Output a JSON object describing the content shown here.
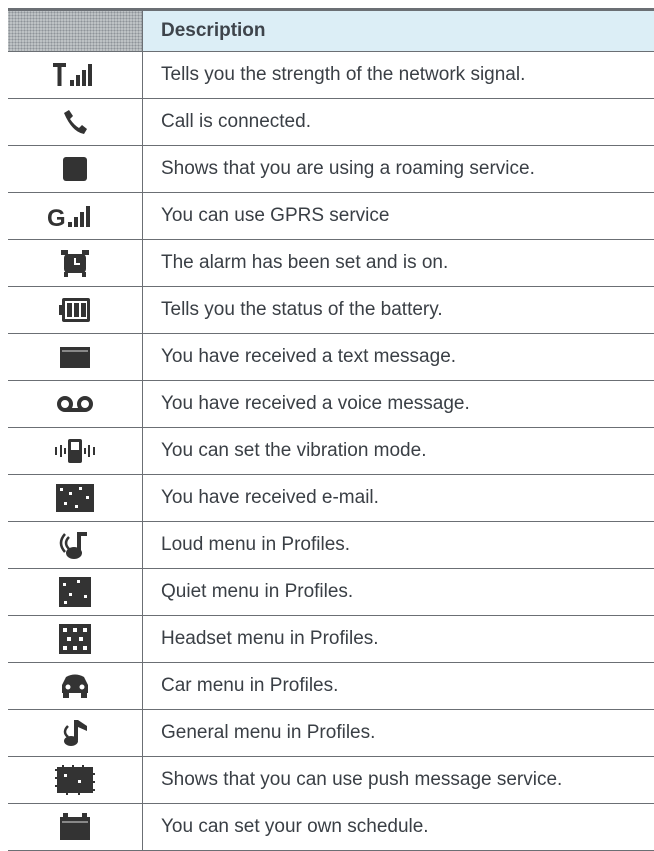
{
  "table": {
    "header": {
      "icon_col": "",
      "description_col": "Description"
    },
    "rows": [
      {
        "icon": "signal-strength-icon",
        "text": "Tells you the strength of the network signal."
      },
      {
        "icon": "call-icon",
        "text": "Call is connected."
      },
      {
        "icon": "roaming-icon",
        "text": "Shows that you are using a roaming service."
      },
      {
        "icon": "gprs-icon",
        "text": "You can use GPRS service"
      },
      {
        "icon": "alarm-icon",
        "text": "The alarm has been set and is on."
      },
      {
        "icon": "battery-icon",
        "text": "Tells you the status of the battery."
      },
      {
        "icon": "text-message-icon",
        "text": "You have received a text message."
      },
      {
        "icon": "voice-message-icon",
        "text": "You have received a voice message."
      },
      {
        "icon": "vibration-icon",
        "text": "You can set the vibration mode."
      },
      {
        "icon": "email-icon",
        "text": "You have received e-mail."
      },
      {
        "icon": "loud-profile-icon",
        "text": "Loud menu in Profiles."
      },
      {
        "icon": "quiet-profile-icon",
        "text": "Quiet menu in Profiles."
      },
      {
        "icon": "headset-profile-icon",
        "text": "Headset menu in Profiles."
      },
      {
        "icon": "car-profile-icon",
        "text": "Car menu in Profiles."
      },
      {
        "icon": "general-profile-icon",
        "text": "General menu in Profiles."
      },
      {
        "icon": "push-message-icon",
        "text": "Shows that you can use push message service."
      },
      {
        "icon": "schedule-icon",
        "text": "You can set your own schedule."
      }
    ]
  }
}
